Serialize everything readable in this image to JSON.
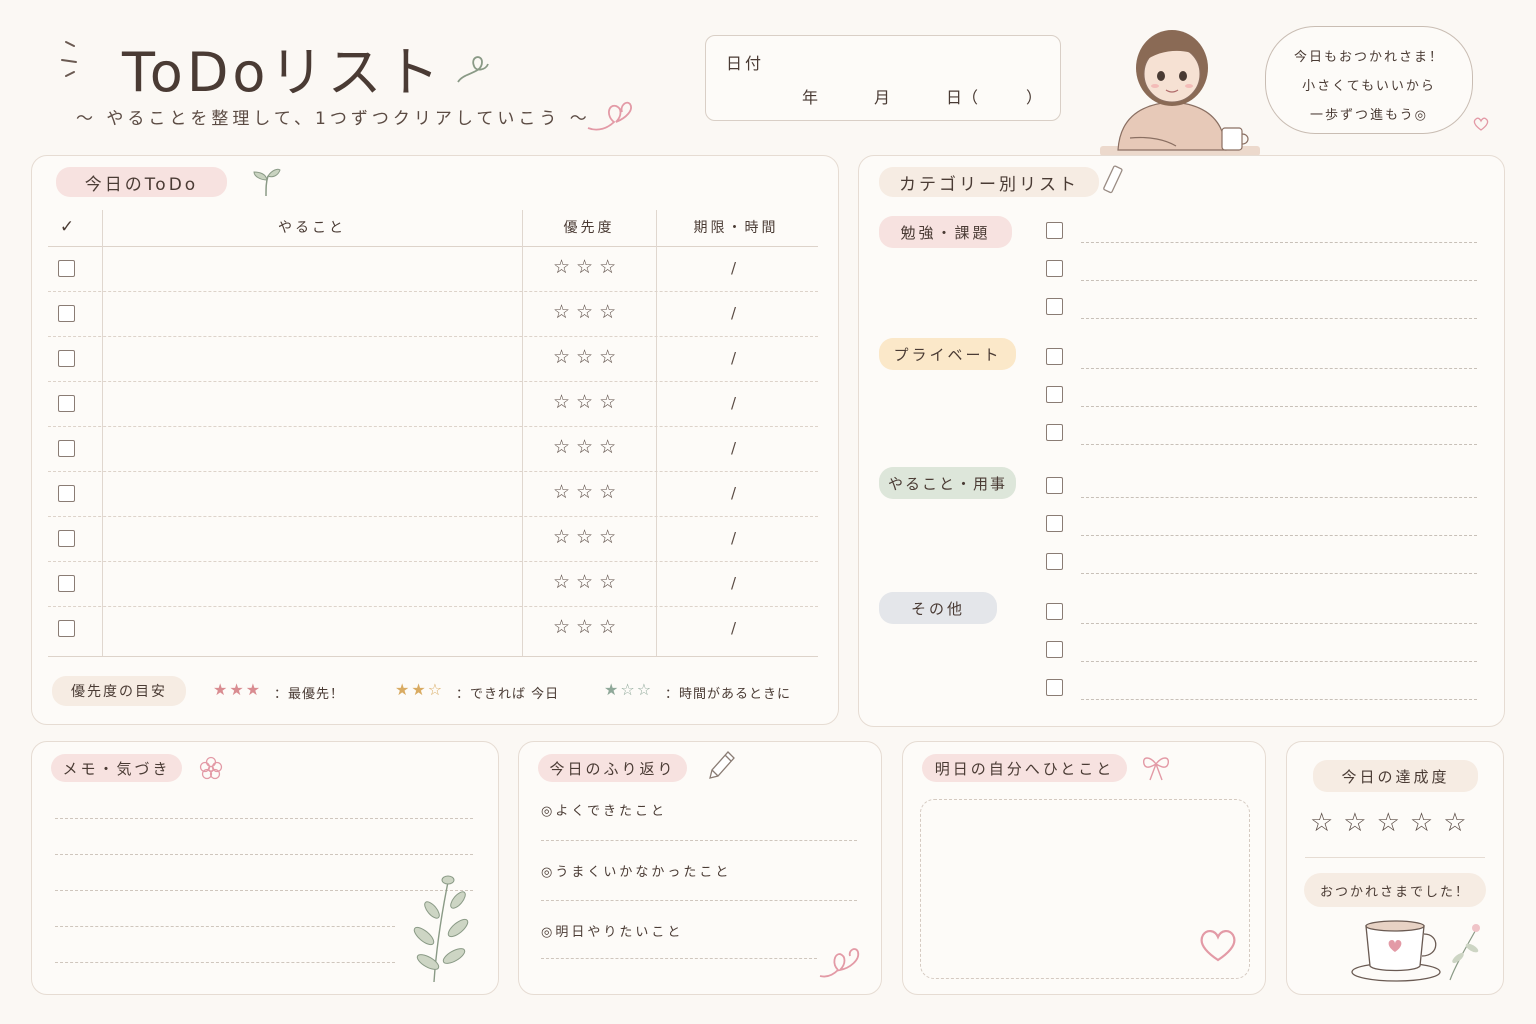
{
  "header": {
    "title": "ToDoリスト",
    "subtitle": "〜 やることを整理して、1つずつクリアしていこう 〜",
    "date_label": "日付",
    "date_year": "年",
    "date_month": "月",
    "date_day": "日（",
    "date_close": "）",
    "bubble_lines": [
      "今日もおつかれさま！",
      "小さくてもいいから",
      "一歩ずつ進もう◎"
    ]
  },
  "today": {
    "label": "今日のToDo",
    "columns": [
      "✓",
      "やること",
      "優先度",
      "期限・時間"
    ],
    "rows": [
      {
        "stars": "☆☆☆",
        "due": "/"
      },
      {
        "stars": "☆☆☆",
        "due": "/"
      },
      {
        "stars": "☆☆☆",
        "due": "/"
      },
      {
        "stars": "☆☆☆",
        "due": "/"
      },
      {
        "stars": "☆☆☆",
        "due": "/"
      },
      {
        "stars": "☆☆☆",
        "due": "/"
      },
      {
        "stars": "☆☆☆",
        "due": "/"
      },
      {
        "stars": "☆☆☆",
        "due": "/"
      },
      {
        "stars": "☆☆☆",
        "due": "/"
      }
    ],
    "legend_label": "優先度の目安",
    "legend": [
      {
        "stars": "★★★",
        "text": "：最優先！",
        "color": "#d98c91"
      },
      {
        "stars": "★★☆",
        "text": "：できれば 今日",
        "color": "#d9ab62"
      },
      {
        "stars": "★☆☆",
        "text": "：時間があるときに",
        "color": "#8fa899"
      }
    ]
  },
  "category": {
    "label": "カテゴリー別リスト",
    "groups": [
      {
        "name": "勉強・課題",
        "color": "pink"
      },
      {
        "name": "プライベート",
        "color": "yellow"
      },
      {
        "name": "やること・用事",
        "color": "green"
      },
      {
        "name": "その他",
        "color": "gray"
      }
    ]
  },
  "memo": {
    "label": "メモ・気づき"
  },
  "reflection": {
    "label": "今日のふり返り",
    "items": [
      "◎よくできたこと",
      "◎うまくいかなかったこと",
      "◎明日やりたいこと"
    ]
  },
  "tomorrow": {
    "label": "明日の自分へひとこと"
  },
  "achievement": {
    "label": "今日の達成度",
    "stars": "☆☆☆☆☆",
    "message": "おつかれさまでした！"
  },
  "colors": {
    "accent_pink": "#f7e2e0",
    "accent_yellow": "#fbe8c9",
    "accent_green": "#dde6da",
    "accent_gray": "#e4e6ea",
    "heart": "#e39aa6",
    "leaf": "#a3ad97"
  }
}
